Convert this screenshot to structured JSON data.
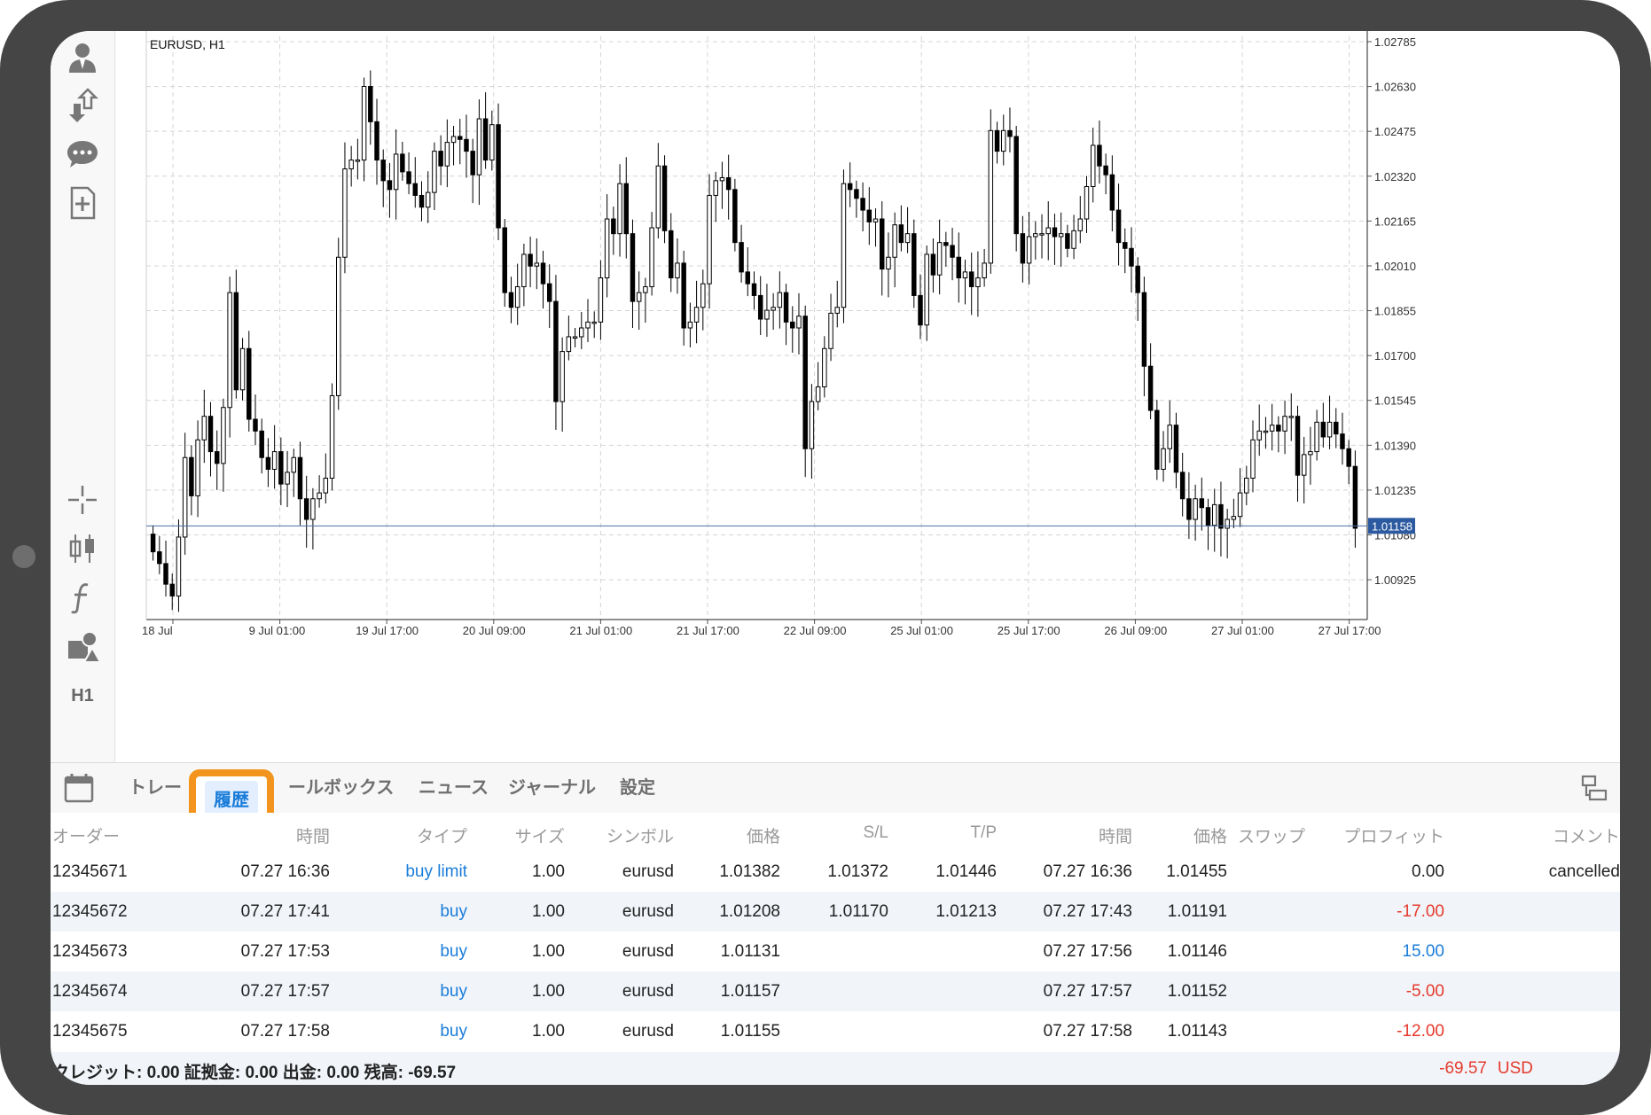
{
  "chart": {
    "symbol_label": "EURUSD, H1",
    "current_price": "1.01158",
    "price_ticks": [
      "1.02785",
      "1.02630",
      "1.02475",
      "1.02320",
      "1.02165",
      "1.02010",
      "1.01855",
      "1.01700",
      "1.01545",
      "1.01390",
      "1.01235",
      "1.01080",
      "1.00925"
    ],
    "time_ticks": [
      "18 Jul",
      "9 Jul 01:00",
      "19 Jul 17:00",
      "20 Jul 09:00",
      "21 Jul 01:00",
      "21 Jul 17:00",
      "22 Jul 09:00",
      "25 Jul 01:00",
      "25 Jul 17:00",
      "26 Jul 09:00",
      "27 Jul 01:00",
      "27 Jul 17:00"
    ],
    "colors": {
      "grid": "#d4d4d4",
      "candle": "#000000",
      "price_line": "#4a6fa5",
      "price_tag": "#2c5aa0"
    }
  },
  "chart_data": {
    "type": "candlestick",
    "symbol": "EURUSD",
    "timeframe": "H1",
    "ylim": [
      1.0084,
      1.0282
    ],
    "current_price": 1.01158,
    "closes": [
      1.0107,
      1.0103,
      1.0096,
      1.0092,
      1.0112,
      1.0139,
      1.0126,
      1.0145,
      1.0153,
      1.0141,
      1.0137,
      1.0156,
      1.0195,
      1.0162,
      1.0176,
      1.0152,
      1.0148,
      1.0139,
      1.0135,
      1.0141,
      1.013,
      1.0134,
      1.0139,
      1.0125,
      1.0118,
      1.0125,
      1.0127,
      1.0132,
      1.016,
      1.0207,
      1.0237,
      1.024,
      1.024,
      1.0265,
      1.0253,
      1.024,
      1.0233,
      1.023,
      1.0242,
      1.0236,
      1.0232,
      1.0228,
      1.0224,
      1.0229,
      1.0243,
      1.0238,
      1.0246,
      1.0248,
      1.0247,
      1.0243,
      1.0235,
      1.0254,
      1.024,
      1.0252,
      1.0217,
      1.0195,
      1.019,
      1.0197,
      1.0208,
      1.0204,
      1.0205,
      1.0198,
      1.0192,
      1.0158,
      1.0175,
      1.018,
      1.018,
      1.0183,
      1.0185,
      1.0185,
      1.02,
      1.022,
      1.0215,
      1.0232,
      1.0215,
      1.0192,
      1.0195,
      1.0197,
      1.0217,
      1.0238,
      1.0216,
      1.02,
      1.0205,
      1.0183,
      1.0185,
      1.019,
      1.0198,
      1.0228,
      1.0233,
      1.0234,
      1.023,
      1.0212,
      1.0202,
      1.0198,
      1.0194,
      1.0186,
      1.0189,
      1.019,
      1.0195,
      1.0185,
      1.0183,
      1.0187,
      1.0142,
      1.0158,
      1.0163,
      1.0176,
      1.0188,
      1.019,
      1.0232,
      1.023,
      1.0227,
      1.0223,
      1.0219,
      1.022,
      1.0203,
      1.0207,
      1.0218,
      1.0212,
      1.0215,
      1.0194,
      1.0184,
      1.0208,
      1.0201,
      1.0212,
      1.0211,
      1.0207,
      1.02,
      1.0202,
      1.0197,
      1.02,
      1.0205,
      1.025,
      1.0243,
      1.025,
      1.0248,
      1.0215,
      1.0205,
      1.0214,
      1.0215,
      1.0215,
      1.0217,
      1.0214,
      1.0215,
      1.021,
      1.0216,
      1.022,
      1.0231,
      1.0245,
      1.0238,
      1.0235,
      1.0223,
      1.0212,
      1.021,
      1.0204,
      1.0195,
      1.017,
      1.0155,
      1.0135,
      1.0142,
      1.015,
      1.0134,
      1.0125,
      1.0118,
      1.0125,
      1.0122,
      1.0116,
      1.0123,
      1.0115,
      1.0118,
      1.0119,
      1.0127,
      1.0132,
      1.0145,
      1.0148,
      1.0148,
      1.015,
      1.0148,
      1.0153,
      1.0153,
      1.0133,
      1.014,
      1.0141,
      1.0151,
      1.0146,
      1.0151,
      1.0147,
      1.0142,
      1.0136,
      1.0115
    ]
  },
  "toolbar": {
    "timeframe": "H1"
  },
  "tabs": [
    {
      "label": "トレー"
    },
    {
      "label": "履歴"
    },
    {
      "label": "ールボックス"
    },
    {
      "label": "ニュース"
    },
    {
      "label": "ジャーナル"
    },
    {
      "label": "設定"
    }
  ],
  "table": {
    "headers": {
      "order": "オーダー",
      "time_open": "時間",
      "type": "タイプ",
      "size": "サイズ",
      "symbol": "シンボル",
      "price_open": "価格",
      "sl": "S/L",
      "tp": "T/P",
      "time_close": "時間",
      "price_close": "価格",
      "swap": "スワップ",
      "profit": "プロフィット",
      "comment": "コメント"
    },
    "rows": [
      {
        "order": "12345671",
        "time_open": "07.27 16:36",
        "type": "buy limit",
        "size": "1.00",
        "symbol": "eurusd",
        "price_open": "1.01382",
        "sl": "1.01372",
        "tp": "1.01446",
        "time_close": "07.27 16:36",
        "price_close": "1.01455",
        "swap": "",
        "profit": "0.00",
        "comment": "cancelled"
      },
      {
        "order": "12345672",
        "time_open": "07.27 17:41",
        "type": "buy",
        "size": "1.00",
        "symbol": "eurusd",
        "price_open": "1.01208",
        "sl": "1.01170",
        "tp": "1.01213",
        "time_close": "07.27 17:43",
        "price_close": "1.01191",
        "swap": "",
        "profit": "-17.00",
        "comment": ""
      },
      {
        "order": "12345673",
        "time_open": "07.27 17:53",
        "type": "buy",
        "size": "1.00",
        "symbol": "eurusd",
        "price_open": "1.01131",
        "sl": "",
        "tp": "",
        "time_close": "07.27 17:56",
        "price_close": "1.01146",
        "swap": "",
        "profit": "15.00",
        "comment": ""
      },
      {
        "order": "12345674",
        "time_open": "07.27 17:57",
        "type": "buy",
        "size": "1.00",
        "symbol": "eurusd",
        "price_open": "1.01157",
        "sl": "",
        "tp": "",
        "time_close": "07.27 17:57",
        "price_close": "1.01152",
        "swap": "",
        "profit": "-5.00",
        "comment": ""
      },
      {
        "order": "12345675",
        "time_open": "07.27 17:58",
        "type": "buy",
        "size": "1.00",
        "symbol": "eurusd",
        "price_open": "1.01155",
        "sl": "",
        "tp": "",
        "time_close": "07.27 17:58",
        "price_close": "1.01143",
        "swap": "",
        "profit": "-12.00",
        "comment": ""
      }
    ]
  },
  "footer": {
    "summary": "クレジット: 0.00 証拠金: 0.00 出金: 0.00 残高: -69.57",
    "total": "-69.57",
    "currency": "USD"
  },
  "colors": {
    "accent": "#1a7cd9",
    "loss": "#e53a2c",
    "highlight": "#f3941e"
  }
}
